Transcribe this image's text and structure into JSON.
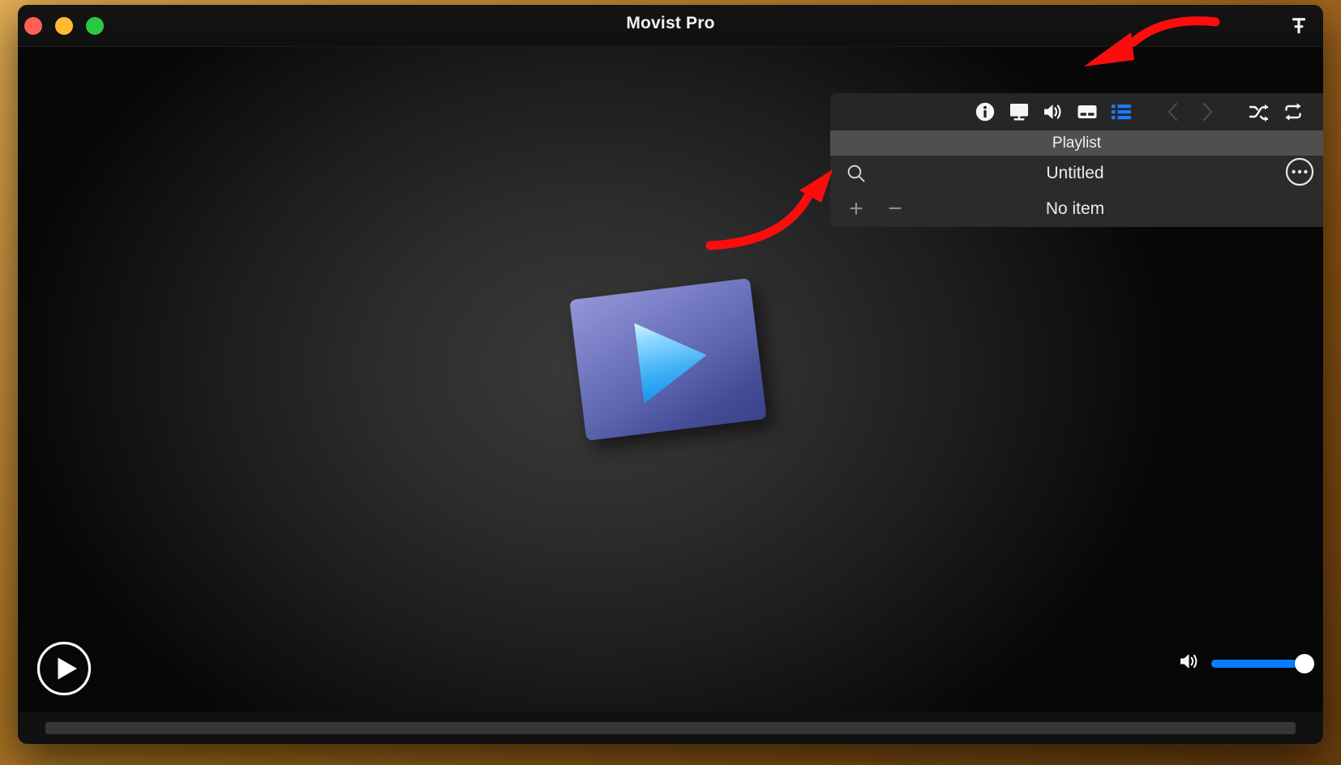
{
  "window": {
    "title": "Movist Pro",
    "traffic_lights": [
      {
        "name": "close",
        "color": "#ff5f57"
      },
      {
        "name": "minimize",
        "color": "#febc2e"
      },
      {
        "name": "maximize",
        "color": "#28c840"
      }
    ],
    "pin_icon": "pin-icon"
  },
  "stage": {
    "logo_alt": "movist-logo",
    "logo_card_color": "#6a71bb",
    "logo_triangle_color": "#3fb0f5"
  },
  "panel": {
    "title": "Playlist",
    "toolbar": [
      {
        "name": "info-icon",
        "label": "Info",
        "state": "normal"
      },
      {
        "name": "display-icon",
        "label": "Video",
        "state": "normal"
      },
      {
        "name": "speaker-icon",
        "label": "Audio",
        "state": "normal"
      },
      {
        "name": "subtitle-icon",
        "label": "Subtitle",
        "state": "normal"
      },
      {
        "name": "playlist-icon",
        "label": "Playlist",
        "state": "selected"
      },
      {
        "name": "previous-icon",
        "label": "Previous",
        "state": "disabled"
      },
      {
        "name": "next-icon",
        "label": "Next",
        "state": "disabled"
      },
      {
        "name": "shuffle-icon",
        "label": "Shuffle",
        "state": "normal"
      },
      {
        "name": "repeat-icon",
        "label": "Repeat",
        "state": "normal"
      }
    ],
    "selected_toolbar_color": "#1a7bfb",
    "rows": [
      {
        "label": "Untitled",
        "left_tools": [
          {
            "name": "search-icon",
            "glyph": "search"
          }
        ],
        "right_tools": [
          {
            "name": "more-options-icon",
            "glyph": "ellipsis"
          }
        ]
      },
      {
        "label": "No item",
        "left_tools": [
          {
            "name": "add-item-button",
            "glyph": "+"
          },
          {
            "name": "remove-item-button",
            "glyph": "−"
          }
        ],
        "right_tools": []
      }
    ]
  },
  "controls": {
    "play_label": "Play",
    "volume_icon": "volume-icon",
    "volume_value": 100,
    "progress_value": 0
  },
  "annotations": [
    {
      "name": "arrow-to-playlist-icon",
      "color": "#fb0d0d"
    },
    {
      "name": "arrow-to-add-button",
      "color": "#fb0d0d"
    }
  ]
}
